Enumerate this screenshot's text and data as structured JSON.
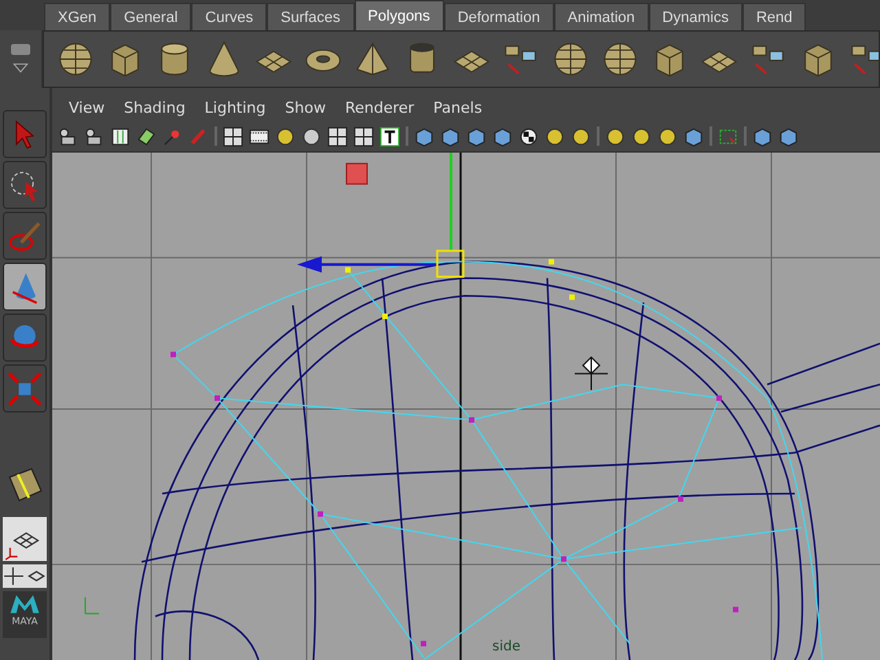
{
  "shelf_tabs": [
    {
      "label": "XGen",
      "selected": false
    },
    {
      "label": "General",
      "selected": false
    },
    {
      "label": "Curves",
      "selected": false
    },
    {
      "label": "Surfaces",
      "selected": false
    },
    {
      "label": "Polygons",
      "selected": true
    },
    {
      "label": "Deformation",
      "selected": false
    },
    {
      "label": "Animation",
      "selected": false
    },
    {
      "label": "Dynamics",
      "selected": false
    },
    {
      "label": "Rend",
      "selected": false
    }
  ],
  "toolbox": [
    {
      "kind": "select",
      "selected": false
    },
    {
      "kind": "lasso",
      "selected": false
    },
    {
      "kind": "paint",
      "selected": false
    },
    {
      "kind": "move",
      "selected": true
    },
    {
      "kind": "rotate",
      "selected": false
    },
    {
      "kind": "scale",
      "selected": false
    }
  ],
  "logo": {
    "text": "MAYA"
  },
  "panel_menu": [
    "View",
    "Shading",
    "Lighting",
    "Show",
    "Renderer",
    "Panels"
  ],
  "viewport": {
    "camera_label": "side"
  }
}
